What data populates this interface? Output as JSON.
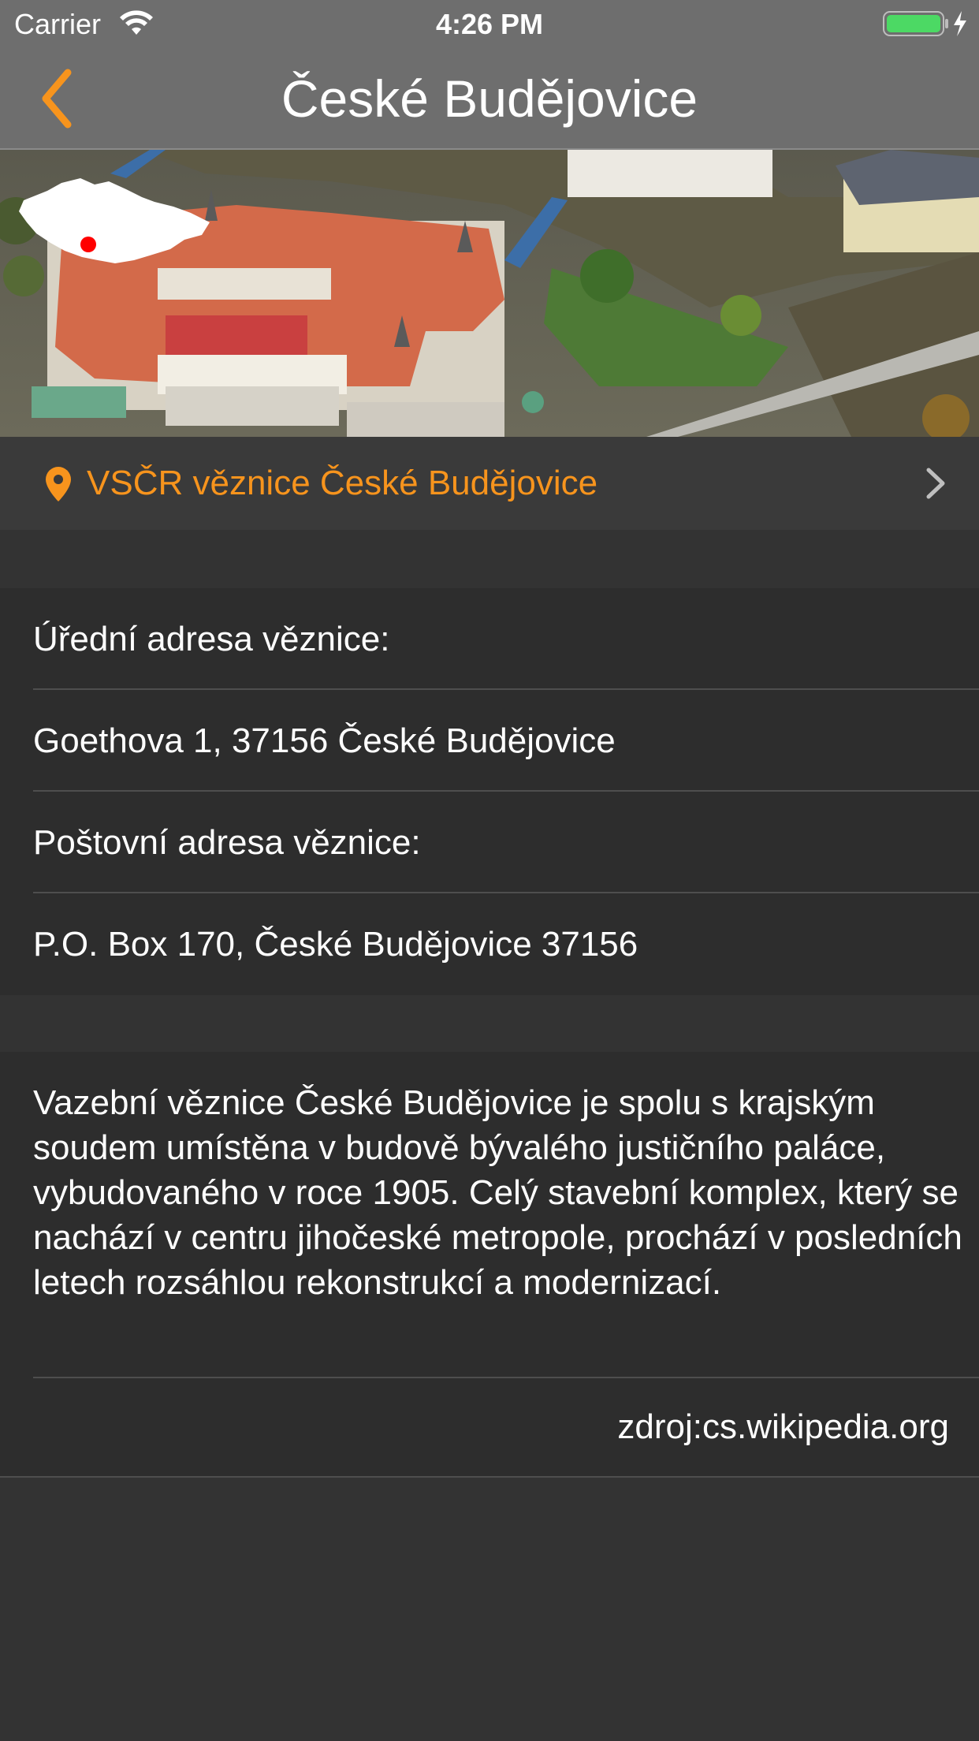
{
  "status_bar": {
    "carrier": "Carrier",
    "time": "4:26 PM",
    "wifi_icon": "wifi-icon",
    "battery_icon": "battery-charging-icon"
  },
  "nav": {
    "title": "České Budějovice",
    "back_icon": "chevron-left-icon",
    "accent_color": "#f7941d"
  },
  "header": {
    "image": "aerial-photo-ceske-budejovice",
    "map_icon": "czech-republic-map-icon",
    "map_marker_color": "#ff0000"
  },
  "location": {
    "label": "VSČR věznice České Budějovice",
    "pin_icon": "location-pin-icon",
    "chevron_icon": "chevron-right-icon"
  },
  "address": {
    "official_label": "Úřední adresa věznice:",
    "official_value": "Goethova 1, 37156 České Budějovice",
    "postal_label": "Poštovní adresa věznice:",
    "postal_value": "P.O. Box 170, České Budějovice 37156"
  },
  "description": {
    "text": "Vazební věznice České Budějovice je spolu s krajským soudem umístěna v budově bývalého justičního paláce, vybudovaného v roce 1905. Celý stavební komplex, který se nachází v centru jihočeské metropole, prochází v posledních letech rozsáhlou rekonstrukcí a modernizací.",
    "source": "zdroj:cs.wikipedia.org"
  }
}
